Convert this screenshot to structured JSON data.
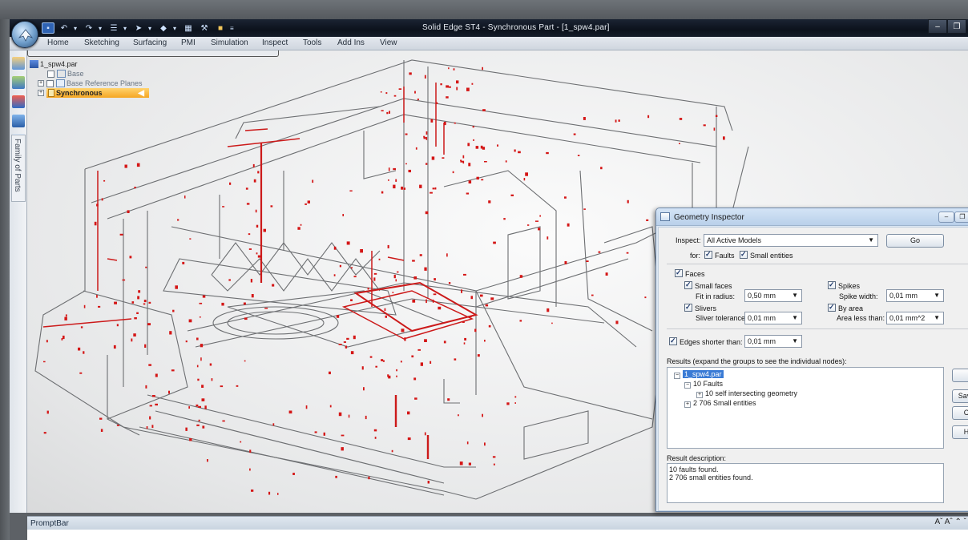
{
  "window": {
    "title": "Solid Edge ST4 - Synchronous Part - [1_spw4.par]"
  },
  "menu": {
    "items": [
      "Home",
      "Sketching",
      "Surfacing",
      "PMI",
      "Simulation",
      "Inspect",
      "Tools",
      "Add Ins",
      "View"
    ]
  },
  "sidebar": {
    "family_tab": "Family of Parts"
  },
  "tree": {
    "root": "1_spw4.par",
    "items": [
      "Base",
      "Base Reference Planes",
      "Synchronous"
    ]
  },
  "dialog": {
    "title": "Geometry Inspector",
    "inspect_label": "Inspect:",
    "inspect_value": "All Active Models",
    "go_label": "Go",
    "for_label": "for:",
    "faults_label": "Faults",
    "small_entities_label": "Small entities",
    "faces_label": "Faces",
    "small_faces_label": "Small faces",
    "fit_radius_label": "Fit in radius:",
    "fit_radius_value": "0,50 mm",
    "spikes_label": "Spikes",
    "spike_width_label": "Spike width:",
    "spike_width_value": "0,01 mm",
    "slivers_label": "Slivers",
    "sliver_tol_label": "Sliver tolerance:",
    "sliver_tol_value": "0,01 mm",
    "by_area_label": "By area",
    "area_less_label": "Area less than:",
    "area_less_value": "0,01 mm^2",
    "edges_label": "Edges shorter than:",
    "edges_value": "0,01 mm",
    "results_label": "Results (expand the groups to see the individual nodes):",
    "results": {
      "root": "1_spw4.par",
      "faults": "10 Faults",
      "self_intersect": "10 self intersecting geometry",
      "small_entities": "2 706 Small entities"
    },
    "side_buttons": [
      "Save",
      "C",
      "H"
    ],
    "result_desc_label": "Result description:",
    "result_desc_lines": [
      "10 faults found.",
      "2 706 small entities found."
    ]
  },
  "promptbar": {
    "title": "PromptBar",
    "controls": "Aˇ Aˆ ⌃ ˇ"
  }
}
